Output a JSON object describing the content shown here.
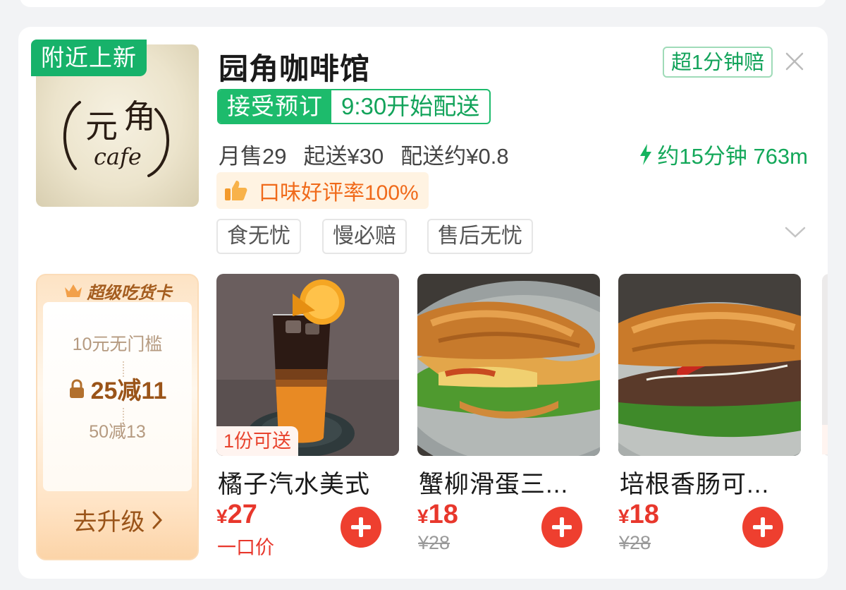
{
  "shop": {
    "badge": "附近上新",
    "name": "园角咖啡馆",
    "compensation_badge": "超1分钟赔",
    "preorder_label": "接受预订",
    "delivery_start": "9:30开始配送",
    "monthly_sales": "月售29",
    "min_order": "起送¥30",
    "delivery_fee": "配送约¥0.8",
    "eta": "约15分钟 763m",
    "rating": "口味好评率100%",
    "services": [
      "食无忧",
      "慢必赔",
      "售后无忧"
    ],
    "logo_text": [
      "元",
      "角",
      "cafe"
    ]
  },
  "member_card": {
    "title": "超级吃货卡",
    "line1": "10元无门槛",
    "main": "25减11",
    "line3": "50减13",
    "upgrade": "去升级"
  },
  "products": [
    {
      "name": "橘子汽水美式",
      "price_symbol": "¥",
      "price": "27",
      "sub": "一口价",
      "tag": "1份可送"
    },
    {
      "name": "蟹柳滑蛋三...",
      "price_symbol": "¥",
      "price": "18",
      "sub": "¥28"
    },
    {
      "name": "培根香肠可...",
      "price_symbol": "¥",
      "price": "18",
      "sub": "¥28"
    }
  ],
  "colors": {
    "green": "#1dbb6c",
    "red": "#ee3f2f",
    "orange": "#f06a1a",
    "gold": "#9a5419"
  }
}
